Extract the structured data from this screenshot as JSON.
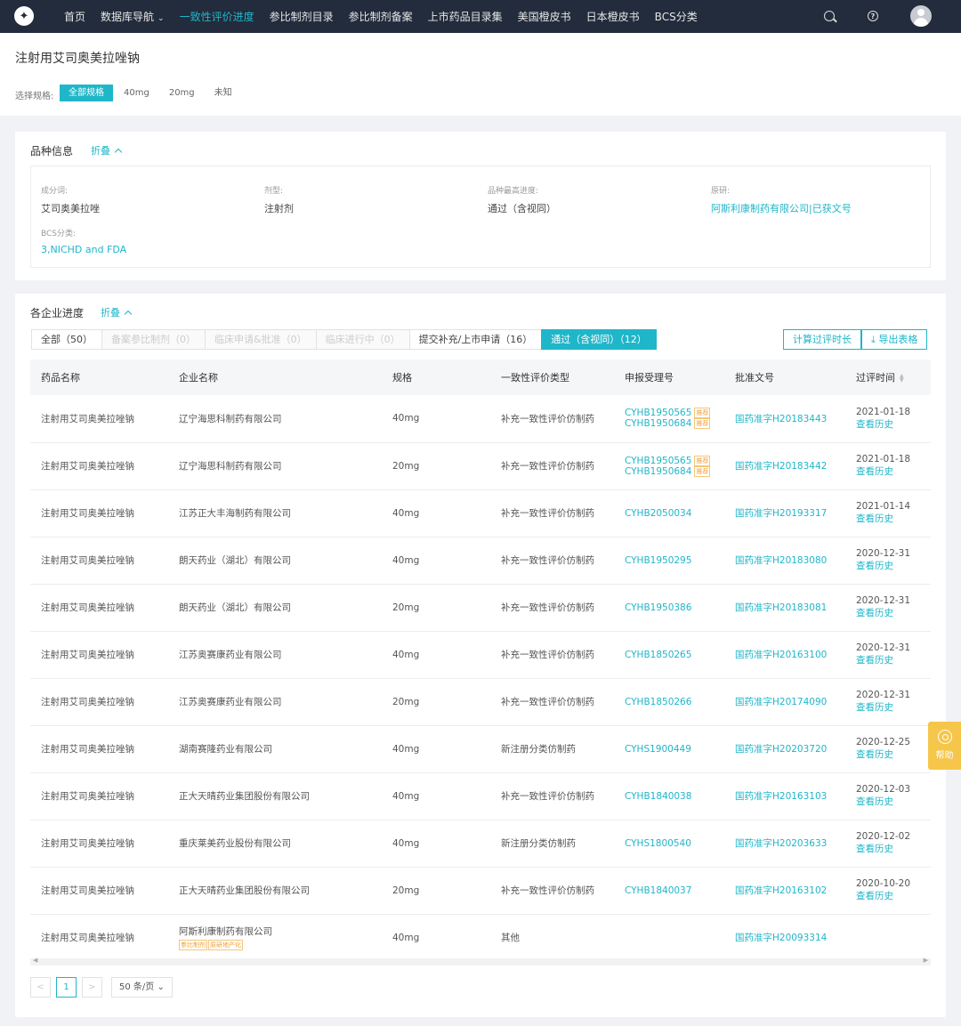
{
  "nav": {
    "logo_glyph": "✦",
    "items": [
      {
        "label": "首页"
      },
      {
        "label": "数据库导航"
      },
      {
        "label": "一致性评价进度"
      },
      {
        "label": "参比制剂目录"
      },
      {
        "label": "参比制剂备案"
      },
      {
        "label": "上市药品目录集"
      },
      {
        "label": "美国橙皮书"
      },
      {
        "label": "日本橙皮书"
      },
      {
        "label": "BCS分类"
      }
    ],
    "help_glyph": "?",
    "accent": "#1fb6c9"
  },
  "page": {
    "title": "注射用艾司奥美拉唑钠",
    "spec_label": "选择规格:",
    "specs": [
      "全部规格",
      "40mg",
      "20mg",
      "未知"
    ]
  },
  "variety_info": {
    "title": "品种信息",
    "collapse": "折叠",
    "fields": {
      "ingredient": {
        "label": "成分词:",
        "value": "艾司奥美拉唑"
      },
      "dosage": {
        "label": "剂型:",
        "value": "注射剂"
      },
      "progress": {
        "label": "品种最高进度:",
        "value": "通过（含视同）"
      },
      "origin": {
        "label": "原研:",
        "value": "阿斯利康制药有限公司|已获文号"
      },
      "bcs": {
        "label": "BCS分类:",
        "value": "3,NICHD and FDA"
      }
    }
  },
  "progress_section": {
    "title": "各企业进度",
    "collapse": "折叠",
    "tabs": [
      {
        "label": "全部（50）"
      },
      {
        "label": "备案参比制剂（0）"
      },
      {
        "label": "临床申请&批准（0）"
      },
      {
        "label": "临床进行中（0）"
      },
      {
        "label": "提交补充/上市申请（16）"
      },
      {
        "label": "通过（含视同）（12）"
      }
    ],
    "calc_button": "计算过评时长",
    "export_button": "导出表格"
  },
  "table": {
    "headers": [
      "药品名称",
      "企业名称",
      "规格",
      "一致性评价类型",
      "申报受理号",
      "批准文号",
      "过评时间"
    ],
    "tag_recommend": "推荐",
    "history_label": "查看历史",
    "rows": [
      {
        "name": "注射用艾司奥美拉唑钠",
        "company": "辽宁海思科制药有限公司",
        "spec": "40mg",
        "type": "补充一致性评价仿制药",
        "accept": [
          "CYHB1950565",
          "CYHB1950684"
        ],
        "approval": "国药准字H20183443",
        "date": "2021-01-18"
      },
      {
        "name": "注射用艾司奥美拉唑钠",
        "company": "辽宁海思科制药有限公司",
        "spec": "20mg",
        "type": "补充一致性评价仿制药",
        "accept": [
          "CYHB1950565",
          "CYHB1950684"
        ],
        "approval": "国药准字H20183442",
        "date": "2021-01-18"
      },
      {
        "name": "注射用艾司奥美拉唑钠",
        "company": "江苏正大丰海制药有限公司",
        "spec": "40mg",
        "type": "补充一致性评价仿制药",
        "accept": [
          "CYHB2050034"
        ],
        "approval": "国药准字H20193317",
        "date": "2021-01-14"
      },
      {
        "name": "注射用艾司奥美拉唑钠",
        "company": "朗天药业（湖北）有限公司",
        "spec": "40mg",
        "type": "补充一致性评价仿制药",
        "accept": [
          "CYHB1950295"
        ],
        "approval": "国药准字H20183080",
        "date": "2020-12-31"
      },
      {
        "name": "注射用艾司奥美拉唑钠",
        "company": "朗天药业（湖北）有限公司",
        "spec": "20mg",
        "type": "补充一致性评价仿制药",
        "accept": [
          "CYHB1950386"
        ],
        "approval": "国药准字H20183081",
        "date": "2020-12-31"
      },
      {
        "name": "注射用艾司奥美拉唑钠",
        "company": "江苏奥赛康药业有限公司",
        "spec": "40mg",
        "type": "补充一致性评价仿制药",
        "accept": [
          "CYHB1850265"
        ],
        "approval": "国药准字H20163100",
        "date": "2020-12-31"
      },
      {
        "name": "注射用艾司奥美拉唑钠",
        "company": "江苏奥赛康药业有限公司",
        "spec": "20mg",
        "type": "补充一致性评价仿制药",
        "accept": [
          "CYHB1850266"
        ],
        "approval": "国药准字H20174090",
        "date": "2020-12-31"
      },
      {
        "name": "注射用艾司奥美拉唑钠",
        "company": "湖南赛隆药业有限公司",
        "spec": "40mg",
        "type": "新注册分类仿制药",
        "accept": [
          "CYHS1900449"
        ],
        "approval": "国药准字H20203720",
        "date": "2020-12-25"
      },
      {
        "name": "注射用艾司奥美拉唑钠",
        "company": "正大天晴药业集团股份有限公司",
        "spec": "40mg",
        "type": "补充一致性评价仿制药",
        "accept": [
          "CYHB1840038"
        ],
        "approval": "国药准字H20163103",
        "date": "2020-12-03"
      },
      {
        "name": "注射用艾司奥美拉唑钠",
        "company": "重庆莱美药业股份有限公司",
        "spec": "40mg",
        "type": "新注册分类仿制药",
        "accept": [
          "CYHS1800540"
        ],
        "approval": "国药准字H20203633",
        "date": "2020-12-02"
      },
      {
        "name": "注射用艾司奥美拉唑钠",
        "company": "正大天晴药业集团股份有限公司",
        "spec": "20mg",
        "type": "补充一致性评价仿制药",
        "accept": [
          "CYHB1840037"
        ],
        "approval": "国药准字H20163102",
        "date": "2020-10-20"
      },
      {
        "name": "注射用艾司奥美拉唑钠",
        "company": "阿斯利康制药有限公司",
        "company_tags": [
          "参比制剂",
          "原研地产化"
        ],
        "spec": "40mg",
        "type": "其他",
        "accept": [],
        "approval": "国药准字H20093314",
        "date": ""
      }
    ]
  },
  "pagination": {
    "prev": "<",
    "current": "1",
    "next": ">",
    "page_size": "50 条/页"
  },
  "help_float": {
    "label": "帮助"
  }
}
